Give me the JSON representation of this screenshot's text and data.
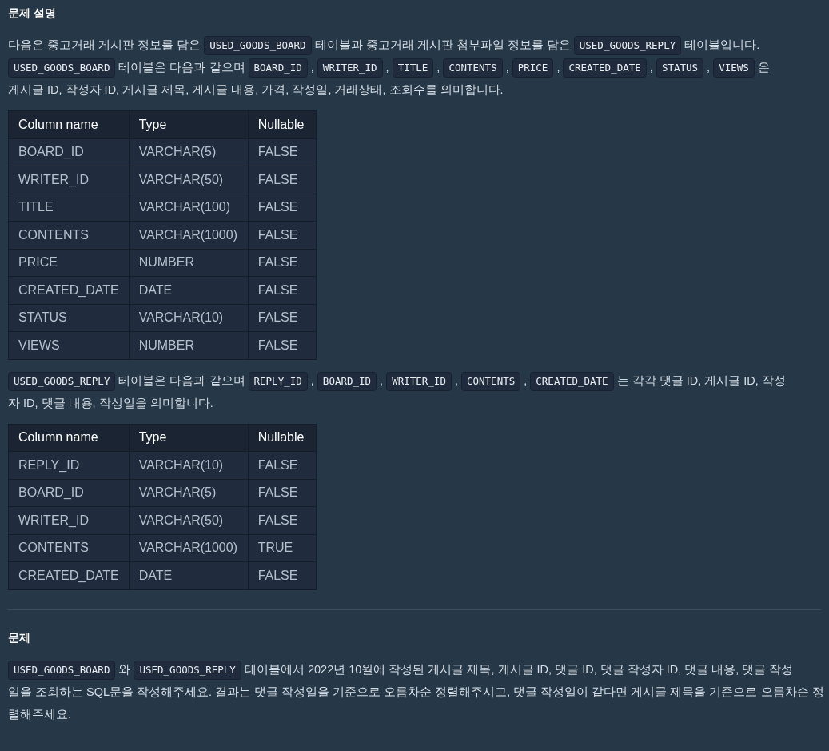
{
  "description_heading": "문제 설명",
  "intro": [
    {
      "kind": "text",
      "text": "다음은 중고거래 게시판 정보를 담은 "
    },
    {
      "kind": "code",
      "text": "USED_GOODS_BOARD"
    },
    {
      "kind": "text",
      "text": " 테이블과 중고거래 게시판 첨부파일 정보를 담은 "
    },
    {
      "kind": "code",
      "text": "USED_GOODS_REPLY"
    },
    {
      "kind": "text",
      "text": " 테이블입니다. "
    },
    {
      "kind": "code",
      "text": "USED_GOODS_BOARD"
    },
    {
      "kind": "text",
      "text": " 테이블은 다음과 같으며 "
    },
    {
      "kind": "code",
      "text": "BOARD_ID"
    },
    {
      "kind": "text",
      "text": " , "
    },
    {
      "kind": "code",
      "text": "WRITER_ID"
    },
    {
      "kind": "text",
      "text": " , "
    },
    {
      "kind": "code",
      "text": "TITLE"
    },
    {
      "kind": "text",
      "text": " , "
    },
    {
      "kind": "code",
      "text": "CONTENTS"
    },
    {
      "kind": "text",
      "text": " , "
    },
    {
      "kind": "code",
      "text": "PRICE"
    },
    {
      "kind": "text",
      "text": " , "
    },
    {
      "kind": "code",
      "text": "CREATED_DATE"
    },
    {
      "kind": "text",
      "text": " , "
    },
    {
      "kind": "code",
      "text": "STATUS"
    },
    {
      "kind": "text",
      "text": " , "
    },
    {
      "kind": "code",
      "text": "VIEWS"
    },
    {
      "kind": "text",
      "text": " 은 "
    },
    {
      "kind": "text",
      "text": "게시글 ID, 작성자 ID, 게시글 제목, 게시글 내용, 가격, 작성일, 거래상태, 조회수를 의미합니다."
    }
  ],
  "board_table": {
    "columns": [
      "Column name",
      "Type",
      "Nullable"
    ],
    "rows": [
      [
        "BOARD_ID",
        "VARCHAR(5)",
        "FALSE"
      ],
      [
        "WRITER_ID",
        "VARCHAR(50)",
        "FALSE"
      ],
      [
        "TITLE",
        "VARCHAR(100)",
        "FALSE"
      ],
      [
        "CONTENTS",
        "VARCHAR(1000)",
        "FALSE"
      ],
      [
        "PRICE",
        "NUMBER",
        "FALSE"
      ],
      [
        "CREATED_DATE",
        "DATE",
        "FALSE"
      ],
      [
        "STATUS",
        "VARCHAR(10)",
        "FALSE"
      ],
      [
        "VIEWS",
        "NUMBER",
        "FALSE"
      ]
    ]
  },
  "reply_intro": [
    {
      "kind": "code",
      "text": "USED_GOODS_REPLY"
    },
    {
      "kind": "text",
      "text": " 테이블은 다음과 같으며 "
    },
    {
      "kind": "code",
      "text": "REPLY_ID"
    },
    {
      "kind": "text",
      "text": " , "
    },
    {
      "kind": "code",
      "text": "BOARD_ID"
    },
    {
      "kind": "text",
      "text": " , "
    },
    {
      "kind": "code",
      "text": "WRITER_ID"
    },
    {
      "kind": "text",
      "text": " , "
    },
    {
      "kind": "code",
      "text": "CONTENTS"
    },
    {
      "kind": "text",
      "text": " , "
    },
    {
      "kind": "code",
      "text": "CREATED_DATE"
    },
    {
      "kind": "text",
      "text": " 는 각각 댓글 ID, 게시글 ID, 작성"
    },
    {
      "kind": "text",
      "text": "자 ID, 댓글 내용, 작성일을 의미합니다."
    }
  ],
  "reply_table": {
    "columns": [
      "Column name",
      "Type",
      "Nullable"
    ],
    "rows": [
      [
        "REPLY_ID",
        "VARCHAR(10)",
        "FALSE"
      ],
      [
        "BOARD_ID",
        "VARCHAR(5)",
        "FALSE"
      ],
      [
        "WRITER_ID",
        "VARCHAR(50)",
        "FALSE"
      ],
      [
        "CONTENTS",
        "VARCHAR(1000)",
        "TRUE"
      ],
      [
        "CREATED_DATE",
        "DATE",
        "FALSE"
      ]
    ]
  },
  "problem_heading": "문제",
  "problem": [
    {
      "kind": "code",
      "text": "USED_GOODS_BOARD"
    },
    {
      "kind": "text",
      "text": " 와 "
    },
    {
      "kind": "code",
      "text": "USED_GOODS_REPLY"
    },
    {
      "kind": "text",
      "text": " 테이블에서 2022년 10월에 작성된 게시글 제목, 게시글 ID, 댓글 ID, 댓글 작성자 ID, 댓글 내용, 댓글 작성"
    },
    {
      "kind": "text",
      "text": "일을 조회하는 SQL문을 작성해주세요. 결과는 댓글 작성일을 기준으로 오름차순 정렬해주시고, 댓글 작성일이 같다면 게시글 제목을 기준으로 오름차순 정"
    },
    {
      "kind": "text",
      "text": "렬해주세요."
    }
  ]
}
